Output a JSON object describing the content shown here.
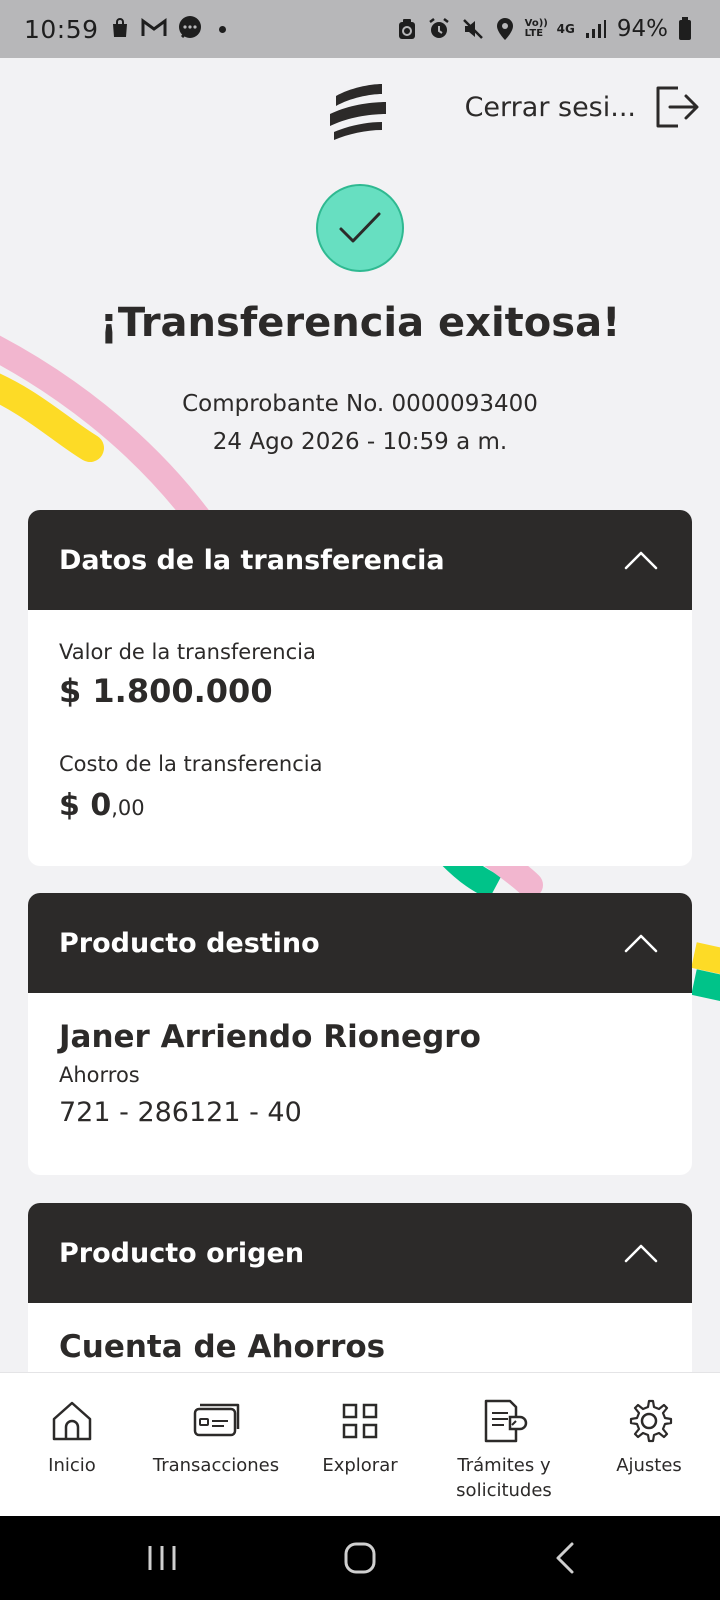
{
  "status_bar": {
    "time": "10:59",
    "battery": "94%",
    "left_icons": [
      "shopping-bag-icon",
      "gmail-icon",
      "messages-icon"
    ],
    "right_icons": [
      "backup-icon",
      "alarm-icon",
      "mute-icon",
      "location-icon",
      "volte-icon",
      "4g-icon",
      "signal-icon",
      "battery-icon"
    ],
    "volte_text": "Vo)) LTE",
    "network_text": "4G"
  },
  "header": {
    "logout_label": "Cerrar sesi..."
  },
  "success": {
    "title": "¡Transferencia exitosa!",
    "receipt": "Comprobante No. 0000093400",
    "datetime": "24 Ago 2026 - 10:59 a m."
  },
  "transfer_card": {
    "title": "Datos de la transferencia",
    "value_label": "Valor de la transferencia",
    "value": "$ 1.800.000",
    "cost_label": "Costo de la transferencia",
    "cost_int": "$ 0",
    "cost_dec": ",00"
  },
  "destination_card": {
    "title": "Producto destino",
    "name": "Janer Arriendo Rionegro",
    "type": "Ahorros",
    "account": "721 - 286121 - 40"
  },
  "origin_card": {
    "title": "Producto origen",
    "name": "Cuenta de Ahorros"
  },
  "bottom_nav": {
    "items": [
      {
        "label": "Inicio",
        "icon": "home-icon"
      },
      {
        "label": "Transacciones",
        "icon": "card-transactions-icon"
      },
      {
        "label": "Explorar",
        "icon": "grid-icon"
      },
      {
        "label": "Trámites y solicitudes",
        "icon": "documents-icon"
      },
      {
        "label": "Ajustes",
        "icon": "gear-icon"
      }
    ]
  },
  "colors": {
    "dark": "#2c2a29",
    "success_green": "#67dfc1",
    "deco_pink": "#f2b6cf",
    "deco_yellow": "#fddb26",
    "deco_green": "#00c389"
  }
}
